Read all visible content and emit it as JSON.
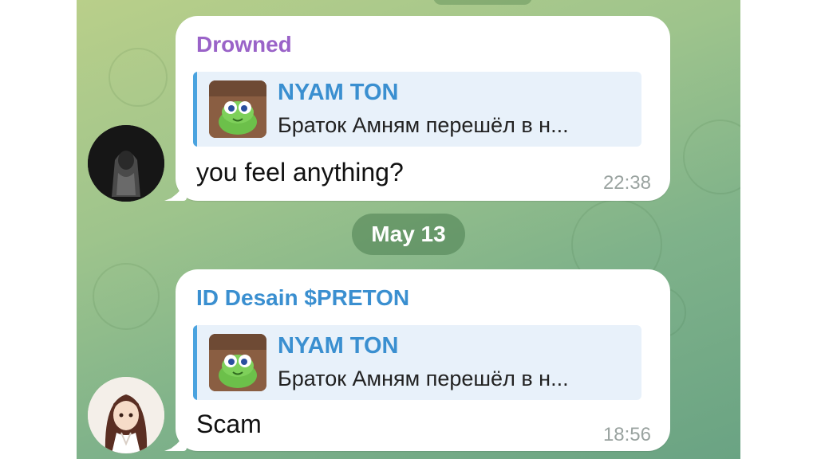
{
  "messages": [
    {
      "sender": "Drowned",
      "sender_color": "#9a63c8",
      "reply": {
        "title": "NYAM TON",
        "text": "Браток Амням перешёл в н..."
      },
      "text": "you feel anything?",
      "time": "22:38",
      "avatar_icon": "dark-hooded-figure-avatar"
    },
    {
      "sender": "ID Desain $PRETON",
      "sender_color": "#3a8fd0",
      "reply": {
        "title": "NYAM TON",
        "text": "Браток Амням перешёл в н..."
      },
      "text": "Scam",
      "time": "18:56",
      "avatar_icon": "anime-girl-avatar"
    }
  ],
  "date_separator": "May 13",
  "colors": {
    "reply_accent": "#4aa3df",
    "reply_bg": "#e8f1fa",
    "bubble_bg": "#ffffff"
  }
}
